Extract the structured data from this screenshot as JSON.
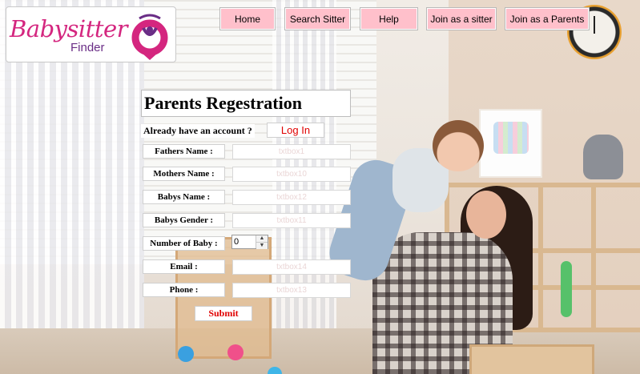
{
  "brand": {
    "name": "Babysitter",
    "sub": "Finder",
    "pink": "#d4267f",
    "purple": "#6a2d86"
  },
  "nav": {
    "items": [
      {
        "label": "Home"
      },
      {
        "label": "Search Sitter"
      },
      {
        "label": "Help"
      },
      {
        "label": "Join as a sitter"
      },
      {
        "label": "Join as a Parents"
      }
    ],
    "button_color": "#ffc0cb"
  },
  "form": {
    "title": "Parents Regestration",
    "already_text": "Already have an account ?",
    "login_label": "Log In",
    "fields": [
      {
        "label": "Fathers Name :",
        "placeholder": "txtbox1"
      },
      {
        "label": "Mothers Name :",
        "placeholder": "txtbox10"
      },
      {
        "label": "Babys Name :",
        "placeholder": "txtbox12"
      },
      {
        "label": "Babys Gender :",
        "placeholder": "txtbox11"
      }
    ],
    "baby_count": {
      "label": "Number of Baby :",
      "value": "0"
    },
    "contact_fields": [
      {
        "label": "Email :",
        "placeholder": "txtbox14"
      },
      {
        "label": "Phone :",
        "placeholder": "txtbox13"
      }
    ],
    "submit_label": "Submit",
    "accent_red": "#e00000"
  }
}
